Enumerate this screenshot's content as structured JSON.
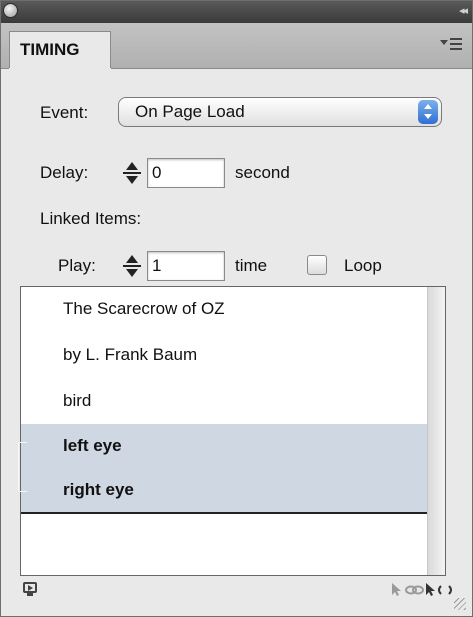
{
  "window": {
    "collapse_glyph": "◂◂"
  },
  "tab": {
    "label": "TIMING",
    "menu_icon": "panel-menu-icon"
  },
  "event": {
    "label": "Event:",
    "selected": "On Page Load"
  },
  "delay": {
    "label": "Delay:",
    "value": "0",
    "unit": "second"
  },
  "linked": {
    "label": "Linked Items:"
  },
  "play": {
    "label": "Play:",
    "value": "1",
    "unit": "time",
    "loop_label": "Loop",
    "loop_checked": false
  },
  "items": [
    {
      "label": "The Scarecrow of OZ",
      "selected": false
    },
    {
      "label": "by L. Frank Baum",
      "selected": false
    },
    {
      "label": "bird",
      "selected": false
    },
    {
      "label": "left eye",
      "selected": true
    },
    {
      "label": "right eye",
      "selected": true
    }
  ],
  "footer": {
    "icons": [
      "preview-icon",
      "link-items-icon",
      "unlink-items-icon",
      "resize-grip-icon"
    ],
    "link_glyph": "⚲",
    "unlink_glyph": "⚲"
  },
  "colors": {
    "selection": "#ced7e2",
    "popup_arrows": "#2f6fd1"
  }
}
